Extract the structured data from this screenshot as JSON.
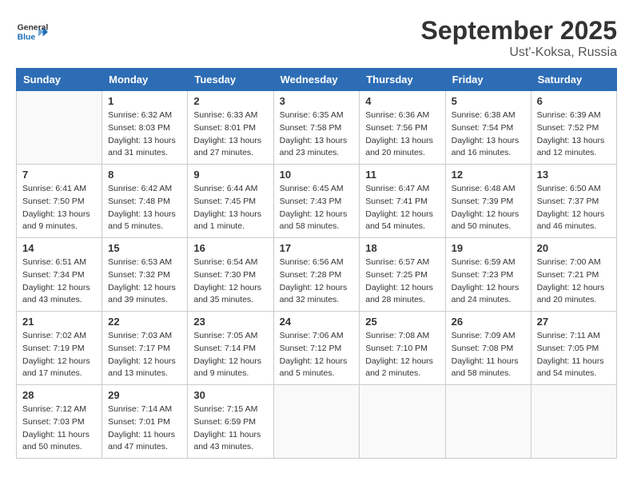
{
  "header": {
    "logo_general": "General",
    "logo_blue": "Blue",
    "month": "September 2025",
    "location": "Ust'-Koksa, Russia"
  },
  "days_of_week": [
    "Sunday",
    "Monday",
    "Tuesday",
    "Wednesday",
    "Thursday",
    "Friday",
    "Saturday"
  ],
  "weeks": [
    [
      {
        "day": "",
        "info": ""
      },
      {
        "day": "1",
        "info": "Sunrise: 6:32 AM\nSunset: 8:03 PM\nDaylight: 13 hours\nand 31 minutes."
      },
      {
        "day": "2",
        "info": "Sunrise: 6:33 AM\nSunset: 8:01 PM\nDaylight: 13 hours\nand 27 minutes."
      },
      {
        "day": "3",
        "info": "Sunrise: 6:35 AM\nSunset: 7:58 PM\nDaylight: 13 hours\nand 23 minutes."
      },
      {
        "day": "4",
        "info": "Sunrise: 6:36 AM\nSunset: 7:56 PM\nDaylight: 13 hours\nand 20 minutes."
      },
      {
        "day": "5",
        "info": "Sunrise: 6:38 AM\nSunset: 7:54 PM\nDaylight: 13 hours\nand 16 minutes."
      },
      {
        "day": "6",
        "info": "Sunrise: 6:39 AM\nSunset: 7:52 PM\nDaylight: 13 hours\nand 12 minutes."
      }
    ],
    [
      {
        "day": "7",
        "info": "Sunrise: 6:41 AM\nSunset: 7:50 PM\nDaylight: 13 hours\nand 9 minutes."
      },
      {
        "day": "8",
        "info": "Sunrise: 6:42 AM\nSunset: 7:48 PM\nDaylight: 13 hours\nand 5 minutes."
      },
      {
        "day": "9",
        "info": "Sunrise: 6:44 AM\nSunset: 7:45 PM\nDaylight: 13 hours\nand 1 minute."
      },
      {
        "day": "10",
        "info": "Sunrise: 6:45 AM\nSunset: 7:43 PM\nDaylight: 12 hours\nand 58 minutes."
      },
      {
        "day": "11",
        "info": "Sunrise: 6:47 AM\nSunset: 7:41 PM\nDaylight: 12 hours\nand 54 minutes."
      },
      {
        "day": "12",
        "info": "Sunrise: 6:48 AM\nSunset: 7:39 PM\nDaylight: 12 hours\nand 50 minutes."
      },
      {
        "day": "13",
        "info": "Sunrise: 6:50 AM\nSunset: 7:37 PM\nDaylight: 12 hours\nand 46 minutes."
      }
    ],
    [
      {
        "day": "14",
        "info": "Sunrise: 6:51 AM\nSunset: 7:34 PM\nDaylight: 12 hours\nand 43 minutes."
      },
      {
        "day": "15",
        "info": "Sunrise: 6:53 AM\nSunset: 7:32 PM\nDaylight: 12 hours\nand 39 minutes."
      },
      {
        "day": "16",
        "info": "Sunrise: 6:54 AM\nSunset: 7:30 PM\nDaylight: 12 hours\nand 35 minutes."
      },
      {
        "day": "17",
        "info": "Sunrise: 6:56 AM\nSunset: 7:28 PM\nDaylight: 12 hours\nand 32 minutes."
      },
      {
        "day": "18",
        "info": "Sunrise: 6:57 AM\nSunset: 7:25 PM\nDaylight: 12 hours\nand 28 minutes."
      },
      {
        "day": "19",
        "info": "Sunrise: 6:59 AM\nSunset: 7:23 PM\nDaylight: 12 hours\nand 24 minutes."
      },
      {
        "day": "20",
        "info": "Sunrise: 7:00 AM\nSunset: 7:21 PM\nDaylight: 12 hours\nand 20 minutes."
      }
    ],
    [
      {
        "day": "21",
        "info": "Sunrise: 7:02 AM\nSunset: 7:19 PM\nDaylight: 12 hours\nand 17 minutes."
      },
      {
        "day": "22",
        "info": "Sunrise: 7:03 AM\nSunset: 7:17 PM\nDaylight: 12 hours\nand 13 minutes."
      },
      {
        "day": "23",
        "info": "Sunrise: 7:05 AM\nSunset: 7:14 PM\nDaylight: 12 hours\nand 9 minutes."
      },
      {
        "day": "24",
        "info": "Sunrise: 7:06 AM\nSunset: 7:12 PM\nDaylight: 12 hours\nand 5 minutes."
      },
      {
        "day": "25",
        "info": "Sunrise: 7:08 AM\nSunset: 7:10 PM\nDaylight: 12 hours\nand 2 minutes."
      },
      {
        "day": "26",
        "info": "Sunrise: 7:09 AM\nSunset: 7:08 PM\nDaylight: 11 hours\nand 58 minutes."
      },
      {
        "day": "27",
        "info": "Sunrise: 7:11 AM\nSunset: 7:05 PM\nDaylight: 11 hours\nand 54 minutes."
      }
    ],
    [
      {
        "day": "28",
        "info": "Sunrise: 7:12 AM\nSunset: 7:03 PM\nDaylight: 11 hours\nand 50 minutes."
      },
      {
        "day": "29",
        "info": "Sunrise: 7:14 AM\nSunset: 7:01 PM\nDaylight: 11 hours\nand 47 minutes."
      },
      {
        "day": "30",
        "info": "Sunrise: 7:15 AM\nSunset: 6:59 PM\nDaylight: 11 hours\nand 43 minutes."
      },
      {
        "day": "",
        "info": ""
      },
      {
        "day": "",
        "info": ""
      },
      {
        "day": "",
        "info": ""
      },
      {
        "day": "",
        "info": ""
      }
    ]
  ]
}
